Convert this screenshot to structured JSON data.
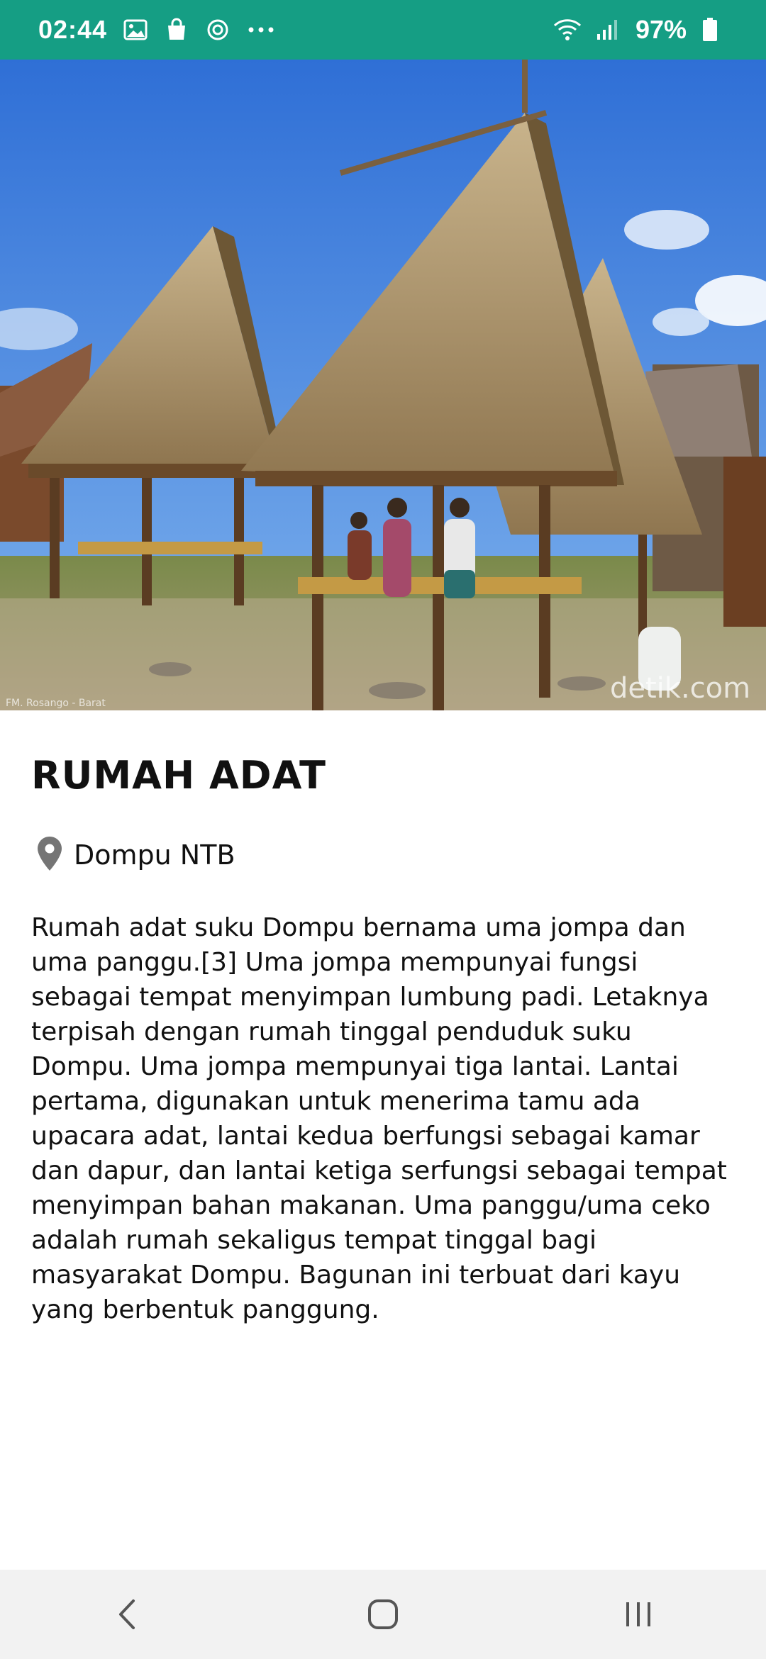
{
  "status_bar": {
    "time": "02:44",
    "battery": "97%",
    "background": "#159e84",
    "left_icons": [
      "gallery-icon",
      "shopping-bag-icon",
      "sync-icon",
      "more-dots-icon"
    ],
    "right_icons": [
      "wifi-icon",
      "signal-icon",
      "battery-icon"
    ]
  },
  "hero": {
    "photo_label": "traditional thatched houses photo",
    "watermark": "detik.com",
    "credit": "FM. Rosango - Barat"
  },
  "content": {
    "title": "RUMAH ADAT",
    "location": "Dompu NTB",
    "description": "Rumah adat suku Dompu bernama uma jompa dan uma panggu.[3] Uma jompa mempunyai fungsi sebagai tempat menyimpan lumbung padi. Letaknya terpisah dengan rumah tinggal penduduk suku Dompu. Uma jompa mempunyai tiga lantai. Lantai pertama, digunakan untuk menerima tamu ada upacara adat, lantai kedua berfungsi sebagai kamar dan dapur, dan lantai ketiga serfungsi sebagai tempat menyimpan bahan makanan. Uma panggu/uma ceko adalah rumah sekaligus tempat tinggal bagi masyarakat Dompu. Bagunan ini terbuat dari kayu yang berbentuk panggung."
  },
  "nav_bar": {
    "buttons": [
      "back",
      "home",
      "recents"
    ]
  }
}
